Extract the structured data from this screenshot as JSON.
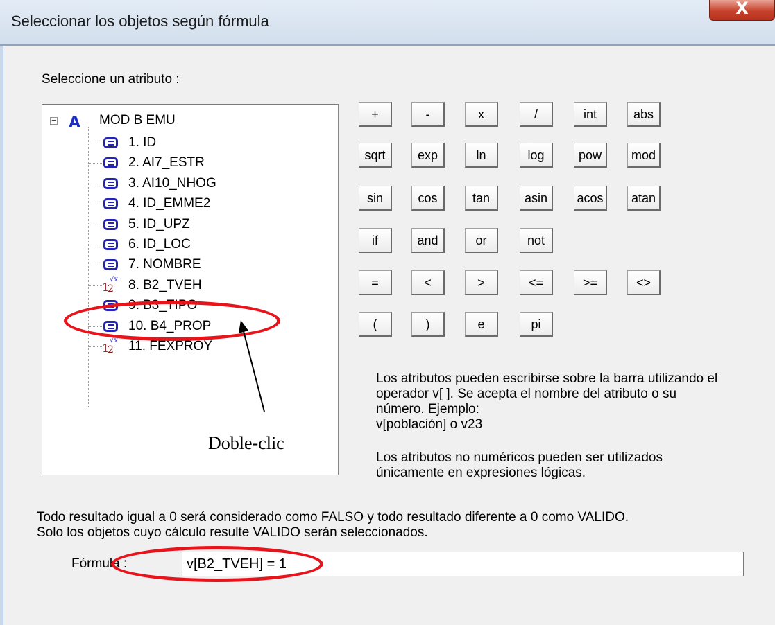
{
  "window": {
    "title": "Seleccionar los objetos según fórmula",
    "close_glyph": "X"
  },
  "attribute_section": {
    "label": "Seleccione un atributo :"
  },
  "tree": {
    "expander_glyph": "−",
    "root": {
      "icon": "layer-icon",
      "glyph": "A",
      "label": "MOD B EMU"
    },
    "items": [
      {
        "label": "1. ID",
        "icon": "list-icon"
      },
      {
        "label": "2. AI7_ESTR",
        "icon": "list-icon"
      },
      {
        "label": "3. AI10_NHOG",
        "icon": "list-icon"
      },
      {
        "label": "4. ID_EMME2",
        "icon": "list-icon"
      },
      {
        "label": "5. ID_UPZ",
        "icon": "list-icon"
      },
      {
        "label": "6. ID_LOC",
        "icon": "list-icon"
      },
      {
        "label": "7. NOMBRE",
        "icon": "list-icon"
      },
      {
        "label": "8. B2_TVEH",
        "icon": "numeric-icon"
      },
      {
        "label": "9. B3_TIPO",
        "icon": "list-icon"
      },
      {
        "label": "10. B4_PROP",
        "icon": "list-icon"
      },
      {
        "label": "11. FEXPROY",
        "icon": "numeric-icon"
      }
    ]
  },
  "numeric_icon": {
    "a": "1",
    "b": "2",
    "c": "√x"
  },
  "operators": [
    [
      "+",
      "-",
      "x",
      "/",
      "int",
      "abs"
    ],
    [
      "sqrt",
      "exp",
      "ln",
      "log",
      "pow",
      "mod"
    ],
    [
      "sin",
      "cos",
      "tan",
      "asin",
      "acos",
      "atan"
    ],
    [
      "if",
      "and",
      "or",
      "not"
    ],
    [
      "=",
      "<",
      ">",
      "<=",
      ">=",
      "<>"
    ],
    [
      "(",
      ")",
      "e",
      "pi"
    ]
  ],
  "info": {
    "line1": "Los atributos pueden escribirse sobre la barra utilizando el",
    "line2": "operador v[ ]. Se acepta el nombre del atributo o su",
    "line3": "número. Ejemplo:",
    "line4": "v[población] o v23",
    "line5": "Los atributos no numéricos pueden ser utilizados",
    "line6": "únicamente en expresiones lógicas."
  },
  "note": {
    "line1": "Todo resultado igual a 0 será considerado como FALSO y todo resultado diferente a 0 como VALIDO.",
    "line2": "Solo los objetos cuyo cálculo resulte VALIDO serán seleccionados."
  },
  "formula": {
    "label": "Fórmula :",
    "value": "v[B2_TVEH] = 1"
  },
  "annotation": {
    "text": "Doble-clic",
    "color": "#e8141b"
  }
}
